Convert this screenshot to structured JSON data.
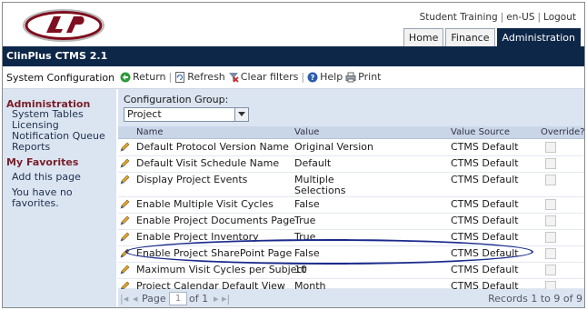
{
  "header": {
    "links": [
      "Student Training",
      "en-US",
      "Logout"
    ],
    "tabs": [
      {
        "label": "Home",
        "active": false
      },
      {
        "label": "Finance",
        "active": false
      },
      {
        "label": "Administration",
        "active": true
      }
    ]
  },
  "app": {
    "name": "ClinPlus CTMS 2.1"
  },
  "page": {
    "title": "System Configuration"
  },
  "toolbar": {
    "return": "Return",
    "refresh": "Refresh",
    "clear_filters": "Clear filters",
    "help": "Help",
    "print": "Print"
  },
  "sidebar": {
    "admin_heading": "Administration",
    "admin_items": [
      "System Tables",
      "Licensing",
      "Notification Queue",
      "Reports"
    ],
    "favorites_heading": "My Favorites",
    "add_page": "Add this page",
    "no_favorites_text": "You have no favorites."
  },
  "config_group": {
    "label": "Configuration Group:",
    "value": "Project"
  },
  "grid": {
    "columns": {
      "name": "Name",
      "value": "Value",
      "source": "Value Source",
      "override": "Override?"
    },
    "rows": [
      {
        "name": "Default Protocol Version Name",
        "value": "Original Version",
        "source": "CTMS Default"
      },
      {
        "name": "Default Visit Schedule Name",
        "value": "Default",
        "source": "CTMS Default"
      },
      {
        "name": "Display Project Events",
        "value": "Multiple",
        "value2": "Selections",
        "source": "CTMS Default"
      },
      {
        "name": "Enable Multiple Visit Cycles",
        "value": "False",
        "source": "CTMS Default"
      },
      {
        "name": "Enable Project Documents Page",
        "value": "True",
        "source": "CTMS Default"
      },
      {
        "name": "Enable Project Inventory",
        "value": "True",
        "source": "CTMS Default"
      },
      {
        "name": "Enable Project SharePoint Page",
        "value": "False",
        "source": "CTMS Default"
      },
      {
        "name": "Maximum Visit Cycles per Subject",
        "value": "10",
        "source": "CTMS Default"
      },
      {
        "name": "Project Calendar Default View",
        "value": "Month",
        "source": "CTMS Default"
      }
    ]
  },
  "pager": {
    "page_label": "Page",
    "page_value": "1",
    "of_label": "of 1",
    "records": "Records 1 to 9 of 9"
  },
  "colors": {
    "navy": "#0d2748",
    "panel": "#dbe5f1",
    "sidebar_heading": "#7a1f2a",
    "highlight_ring": "#1a2a8c"
  }
}
